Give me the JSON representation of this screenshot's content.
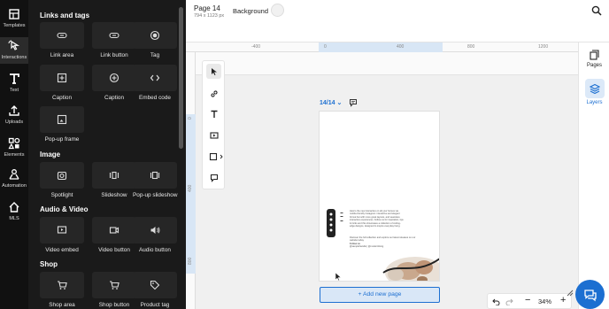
{
  "rail": {
    "items": [
      {
        "label": "Templates",
        "icon": "templates-icon"
      },
      {
        "label": "Interactions",
        "icon": "interactions-icon"
      },
      {
        "label": "Text",
        "icon": "text-icon"
      },
      {
        "label": "Uploads",
        "icon": "upload-icon"
      },
      {
        "label": "Elements",
        "icon": "elements-icon"
      },
      {
        "label": "Automation",
        "icon": "automation-icon"
      },
      {
        "label": "MLS",
        "icon": "home-icon"
      }
    ]
  },
  "panel": {
    "sections": [
      {
        "title": "Links and tags",
        "tiles": [
          "Link area",
          "Link button",
          "Tag",
          "Caption",
          "Caption",
          "Embed code",
          "Pop-up frame"
        ]
      },
      {
        "title": "Image",
        "tiles": [
          "Spotlight",
          "Slideshow",
          "Pop-up slideshow"
        ]
      },
      {
        "title": "Audio & Video",
        "tiles": [
          "Video embed",
          "Video button",
          "Audio button"
        ]
      },
      {
        "title": "Shop",
        "tiles": [
          "Shop area",
          "Shop button",
          "Product tag"
        ]
      }
    ]
  },
  "topbar": {
    "page_title": "Page 14",
    "page_size": "794 x 1123 px",
    "background_label": "Background",
    "background_color": "#f1f1f1"
  },
  "right_panel": {
    "pages_label": "Pages",
    "layers_label": "Layers"
  },
  "rulers": {
    "h_ticks": [
      "-400",
      "0",
      "400",
      "800",
      "1200"
    ],
    "v_ticks": [
      "0",
      "400",
      "800"
    ]
  },
  "canvas": {
    "page_nav": "14/14",
    "page_content": {
      "body_text": "Here's the new interactive on all your homes via mobile-friendly Instagram: interactive and elegant format but with more great layouts, and seamless interactive experiences. Follow us for inspiration, tips & tricks and this showcases a collection of cutting-edge designs, designed to inspire everyday living.",
      "follow_text": "Discover the full collection and explore our latest releases on our website today.",
      "follow_label": "Follow us",
      "handles": "@samplehandle | @modernliving"
    },
    "add_page_label": "+ Add new page"
  },
  "zoom": {
    "value": "34%"
  },
  "colors": {
    "accent": "#1c6fd1",
    "panel_bg": "#1a1a1a",
    "rail_bg": "#111111"
  }
}
